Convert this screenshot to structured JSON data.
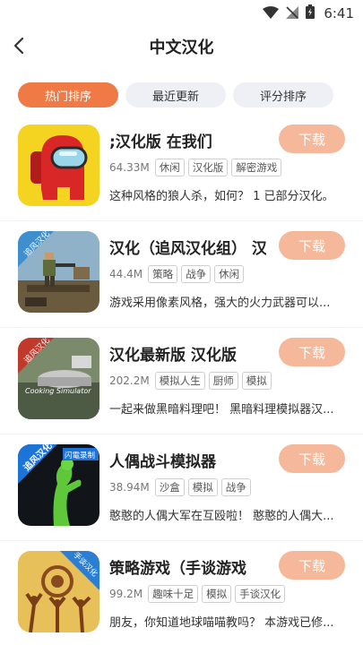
{
  "status_bar": {
    "time": "6:41"
  },
  "header": {
    "title": "中文汉化"
  },
  "tabs": [
    {
      "label": "热门排序",
      "active": true
    },
    {
      "label": "最近更新",
      "active": false
    },
    {
      "label": "评分排序",
      "active": false
    }
  ],
  "download_label": "下载",
  "apps": [
    {
      "title": ";汉化版      在我们",
      "size": "64.33M",
      "tags": [
        "休闲",
        "汉化版",
        "解密游戏"
      ],
      "description": "这种风格的狼人杀，如何？ 1 已部分汉化。",
      "icon": "among-us-icon"
    },
    {
      "title": "汉化（追风汉化组） 汉",
      "size": "44.4M",
      "tags": [
        "策略",
        "战争",
        "休闲"
      ],
      "description": "游戏采用像素风格，强大的火力武器可以...",
      "icon": "pixel-war-icon",
      "icon_label": "追风汉化"
    },
    {
      "title": "汉化最新版 汉化版",
      "size": "202.2M",
      "tags": [
        "模拟人生",
        "厨师",
        "模拟"
      ],
      "description": "一起来做黑暗料理吧！ 黑暗料理模拟器汉...",
      "icon": "cooking-simulator-icon",
      "icon_label": "追风汉化",
      "icon_caption": "Cooking Simulator"
    },
    {
      "title": "人偶战斗模拟器",
      "size": "38.94M",
      "tags": [
        "沙盒",
        "模拟",
        "战争"
      ],
      "description": "憨憨的人偶大军在互殴啦！ 憨憨的人偶大...",
      "icon": "puppet-fight-icon",
      "icon_label": "追风汉化",
      "icon_badge": "闪電录制"
    },
    {
      "title": "策略游戏（手谈游戏",
      "size": "99.2M",
      "tags": [
        "趣味十足",
        "模拟",
        "手谈汉化"
      ],
      "description": "朋友，你知道地球喵喵教吗？ 本游戏已修...",
      "icon": "tribe-strategy-icon",
      "icon_badge": "手谈汉化"
    }
  ]
}
